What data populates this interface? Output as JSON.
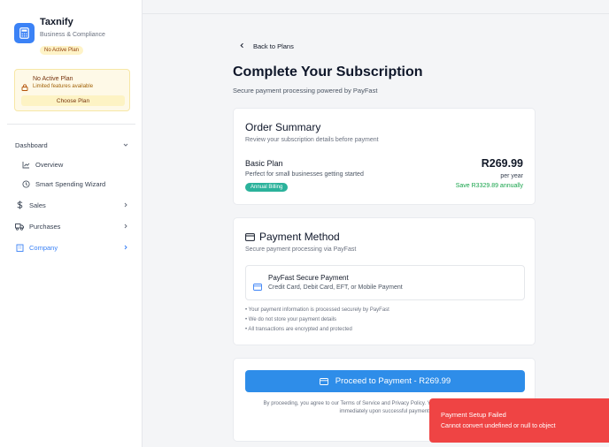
{
  "brand": {
    "name": "Taxnify",
    "subtitle": "Business & Compliance",
    "badge": "No Active Plan"
  },
  "plan_notice": {
    "title": "No Active Plan",
    "description": "Limited features available",
    "button": "Choose Plan"
  },
  "nav": {
    "dashboard": "Dashboard",
    "overview": "Overview",
    "wizard": "Smart Spending Wizard",
    "sales": "Sales",
    "purchases": "Purchases",
    "company": "Company"
  },
  "back_label": "Back to Plans",
  "page": {
    "title": "Complete Your Subscription",
    "subtitle": "Secure payment processing powered by PayFast"
  },
  "order": {
    "title": "Order Summary",
    "subtitle": "Review your subscription details before payment",
    "plan_name": "Basic Plan",
    "plan_tagline": "Perfect for small businesses getting started",
    "billing_badge": "Annual Billing",
    "price": "R269.99",
    "period": "per year",
    "savings": "Save R3329.89 annually"
  },
  "payment": {
    "title": "Payment Method",
    "subtitle": "Secure payment processing via PayFast",
    "option_title": "PayFast Secure Payment",
    "option_desc": "Credit Card, Debit Card, EFT, or Mobile Payment",
    "notes": [
      "• Your payment information is processed securely by PayFast",
      "• We do not store your payment details",
      "• All transactions are encrypted and protected"
    ]
  },
  "checkout": {
    "button": "Proceed to Payment - R269.99",
    "terms_line1": "By proceeding, you agree to our Terms of Service and Privacy Policy. Your subscription will be activated",
    "terms_line2": "immediately upon successful payment."
  },
  "toast": {
    "title": "Payment Setup Failed",
    "message": "Cannot convert undefined or null to object"
  },
  "colors": {
    "accent": "#2e8de9",
    "sidebar_active": "#3b82f6",
    "toast": "#ef4444",
    "badge": "#2bb29b",
    "savings": "#16a34a"
  }
}
